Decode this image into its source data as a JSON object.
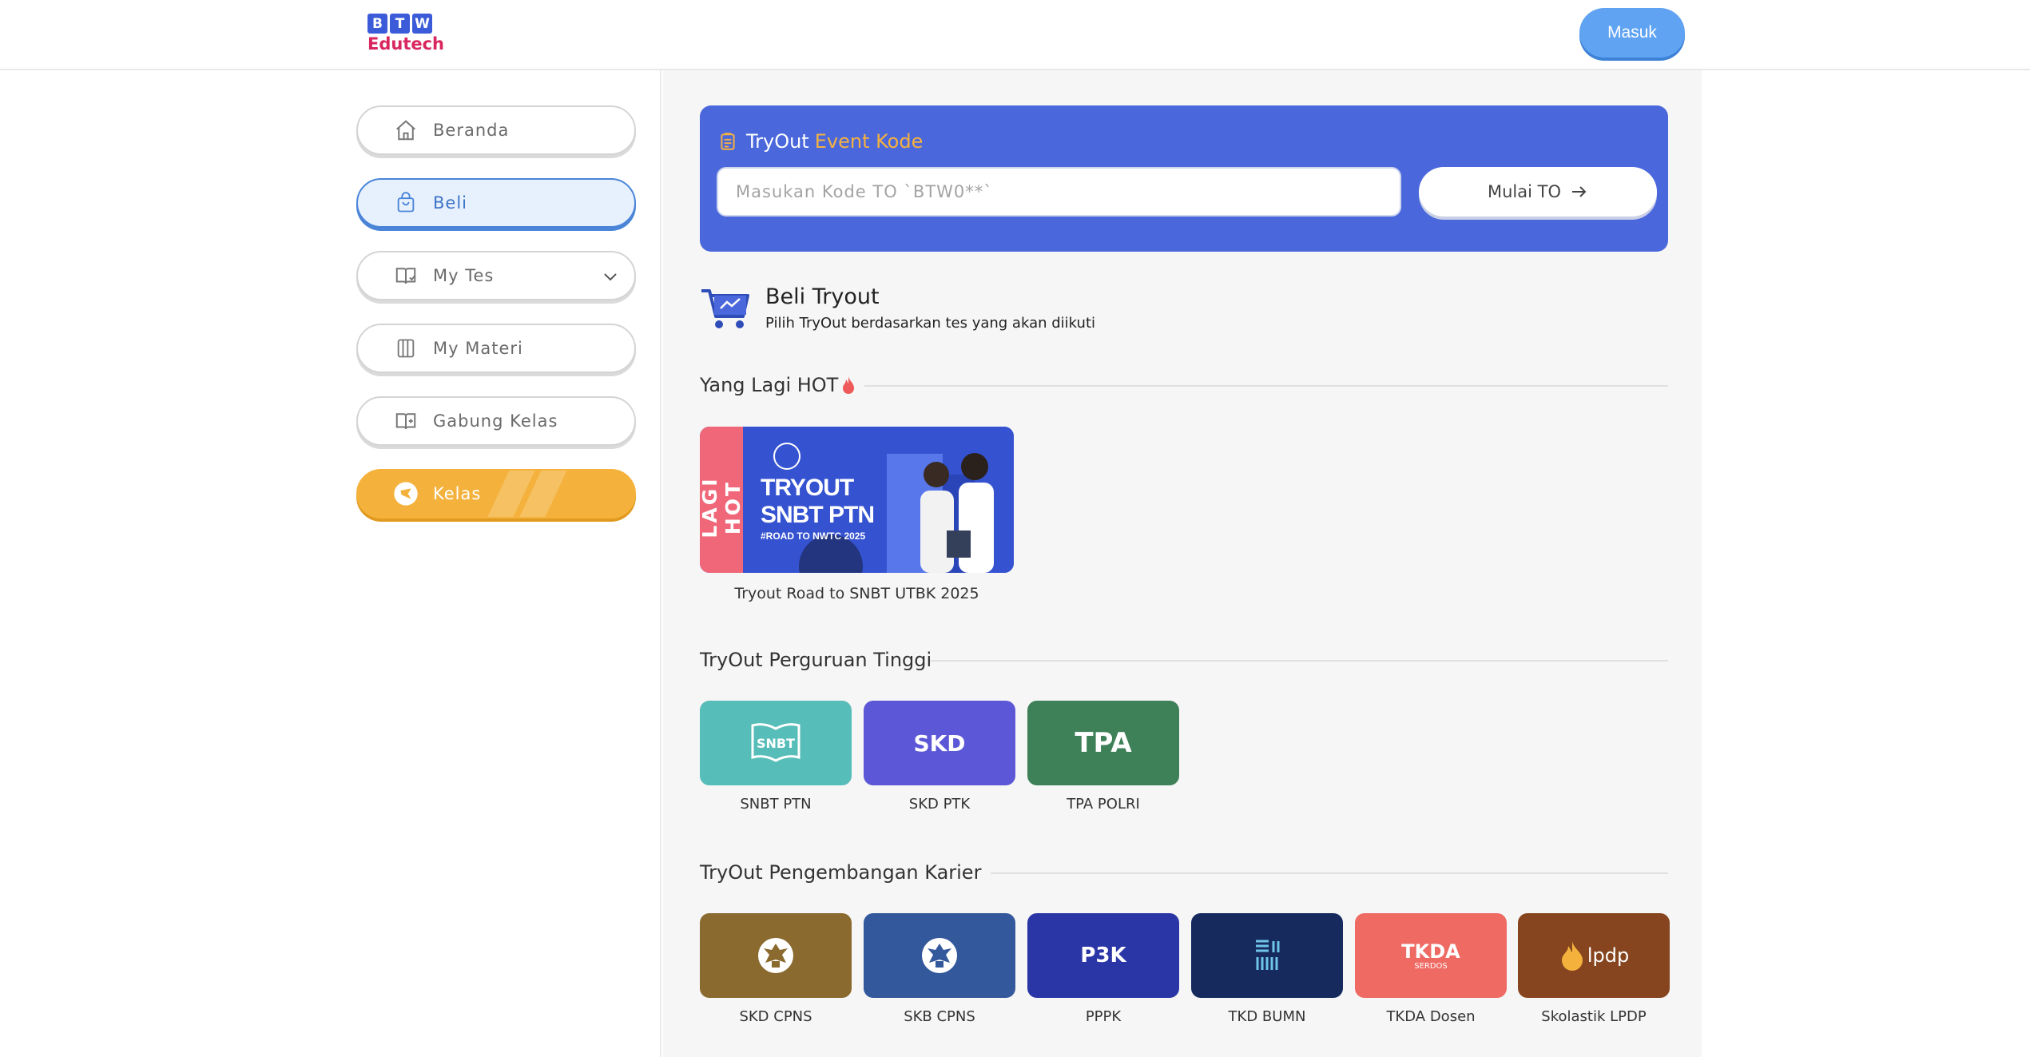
{
  "header": {
    "logo_letters": [
      "B",
      "T",
      "W"
    ],
    "logo_word": "Edutech",
    "login_label": "Masuk"
  },
  "sidebar": {
    "items": [
      {
        "label": "Beranda",
        "icon": "home-icon"
      },
      {
        "label": "Beli",
        "icon": "shopping-bag-icon",
        "active": true
      },
      {
        "label": "My Tes",
        "icon": "book-icon"
      },
      {
        "label": "My Materi",
        "icon": "notebook-icon"
      },
      {
        "label": "Gabung Kelas",
        "icon": "book-open-icon"
      },
      {
        "label": "Kelas",
        "icon": "class-icon"
      }
    ]
  },
  "event": {
    "title": "TryOut",
    "title_accent": "Event Kode",
    "input_placeholder": "Masukan Kode TO `BTW0**`",
    "start_label": "Mulai TO"
  },
  "beli": {
    "title": "Beli Tryout",
    "subtitle": "Pilih TryOut berdasarkan tes yang akan diikuti"
  },
  "hot": {
    "section_title": "Yang Lagi HOT",
    "banner_side": "LAGI HOT",
    "banner_line1": "TRYOUT",
    "banner_line2": "SNBT PTN",
    "banner_line3": "#ROAD TO NWTC 2025",
    "caption": "Tryout Road to SNBT UTBK 2025"
  },
  "pt": {
    "section_title": "TryOut Perguruan Tinggi",
    "tiles": [
      {
        "label": "SNBT PTN",
        "logo": "SNBT",
        "color": "#57bdb8"
      },
      {
        "label": "SKD PTK",
        "logo": "SKD",
        "color": "#5b57d6"
      },
      {
        "label": "TPA POLRI",
        "logo": "TPA",
        "color": "#3e8058"
      }
    ]
  },
  "karier": {
    "section_title": "TryOut Pengembangan Karier",
    "tiles": [
      {
        "label": "SKD CPNS",
        "color": "#8a6a2e"
      },
      {
        "label": "SKB CPNS",
        "color": "#33589b"
      },
      {
        "label": "PPPK",
        "logo": "P3K",
        "color": "#2b36a6"
      },
      {
        "label": "TKD BUMN",
        "color": "#162a5e"
      },
      {
        "label": "TKDA Dosen",
        "logo": "TKDA",
        "logo_sub": "SERDOS",
        "color": "#ee6a63"
      },
      {
        "label": "Skolastik LPDP",
        "logo": "lpdp",
        "color": "#86451f"
      }
    ]
  }
}
